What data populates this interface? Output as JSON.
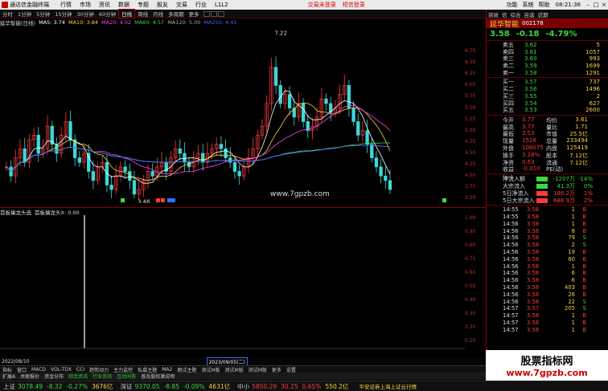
{
  "menubar": {
    "app_title": "通达信金融终端",
    "items": [
      "行情",
      "市场",
      "资讯",
      "数据",
      "专题",
      "股友",
      "交易",
      "行业",
      "L1L2"
    ],
    "alerts": [
      "交易未登录",
      "短信登录"
    ],
    "right_items": [
      "功能",
      "系统",
      "帮助"
    ],
    "clock": "08:21:36"
  },
  "periodbar": {
    "periods": [
      "分时",
      "1分钟",
      "5分钟",
      "15分钟",
      "30分钟",
      "60分钟",
      "日线",
      "周线",
      "月线",
      "多周期",
      "更多"
    ],
    "active": "日线"
  },
  "indicator_line": {
    "title": "延华智能(日线)",
    "ma": [
      {
        "label": "MA5: 3.74",
        "color": "#ffffff"
      },
      {
        "label": "MA10: 3.84",
        "color": "#ffd23c"
      },
      {
        "label": "MA20: 4.02",
        "color": "#ff44ff"
      },
      {
        "label": "MA60: 4.57",
        "color": "#3cd83c"
      },
      {
        "label": "MA120: 5.00",
        "color": "#aaaaaa"
      },
      {
        "label": "MA250: 4.41",
        "color": "#3a6cff"
      }
    ]
  },
  "chart_annotations": {
    "high_label": "7.22",
    "low_label": "3.46",
    "watermark": "www.7gpzb.com",
    "sub_value": "0.71"
  },
  "chart_data": {
    "type": "candlestick",
    "price_axis": [
      "6.75",
      "6.50",
      "6.25",
      "6.00",
      "5.75",
      "5.50",
      "5.25",
      "5.00",
      "4.75",
      "4.50",
      "4.25",
      "4.00",
      "3.75",
      "3.50"
    ],
    "high": 7.22,
    "low": 3.46,
    "closes": [
      4.2,
      4.0,
      4.4,
      4.6,
      4.3,
      4.8,
      4.9,
      4.5,
      4.6,
      5.1,
      4.7,
      4.5,
      4.9,
      5.2,
      4.8,
      4.4,
      4.3,
      4.5,
      4.1,
      3.9,
      4.2,
      4.3,
      3.8,
      3.7,
      4.0,
      4.2,
      4.1,
      3.9,
      3.6,
      3.7,
      3.9,
      4.1,
      4.0,
      4.2,
      4.3,
      4.1,
      4.4,
      4.6,
      4.5,
      4.3,
      4.2,
      4.4,
      4.5,
      4.3,
      4.5,
      4.6,
      4.7,
      4.6,
      4.4,
      4.3,
      4.1,
      4.0,
      4.2,
      4.4,
      4.6,
      4.9,
      5.1,
      5.6,
      6.4,
      6.0,
      5.6,
      5.8,
      5.5,
      5.3,
      5.6,
      5.2,
      5.0,
      5.1,
      5.3,
      5.7,
      5.6,
      5.4,
      5.5,
      5.8,
      6.0,
      5.5,
      5.2,
      4.9,
      5.0,
      4.7,
      4.4,
      4.2,
      4.0,
      3.9,
      3.7
    ]
  },
  "sub_indicator": {
    "title": "首板擒龙头选",
    "label": "首板擒龙头X: 0.00",
    "axis": [
      "1.00",
      "0.90",
      "0.80",
      "0.71",
      "0.60",
      "0.50",
      "0.40",
      "0.30",
      "0.20",
      "0.10"
    ]
  },
  "date_axis": {
    "left": "2022/08/10",
    "mid": "2023/09/05(二)"
  },
  "tabs1": [
    "指标",
    "窗口",
    "MACD",
    "VOL-TDX",
    "CCI",
    "趋势动力",
    "主力监控",
    "私募主题",
    "MA2",
    "朗试主题",
    "测试M版",
    "测试M版",
    "测试M版",
    "更多",
    "设置"
  ],
  "tabs2": {
    "items": [
      "扩展A",
      "关联报价",
      "资金分布",
      "综合资讯",
      "行业资讯",
      "互动问答",
      "普及股权激说明"
    ],
    "green_index": [
      3,
      4,
      5
    ]
  },
  "status": {
    "items": [
      {
        "label": "上证",
        "value": "3078.49",
        "chg": "-8.32",
        "pct": "-0.27%",
        "vol": "3676亿"
      },
      {
        "label": "深证",
        "value": "9370.05",
        "chg": "-8.85",
        "pct": "-0.09%",
        "vol": "4631亿"
      },
      {
        "label": "中小",
        "value": "5850.29",
        "chg": "30.25",
        "pct": "0.65%",
        "vol": "550.2亿"
      }
    ],
    "right_text": "平安证券上海上证云行情"
  },
  "rpanel": {
    "top": [
      "资收",
      "信",
      "综合",
      "自选",
      "近期"
    ],
    "name": "延华智能",
    "code": "002178",
    "price": "3.58",
    "change": "-0.18",
    "pct": "-4.79%",
    "asks": [
      {
        "k": "卖五",
        "p": "3.62",
        "v": "5"
      },
      {
        "k": "卖四",
        "p": "3.61",
        "v": "1057"
      },
      {
        "k": "卖三",
        "p": "3.60",
        "v": "993"
      },
      {
        "k": "卖二",
        "p": "3.59",
        "v": "1699"
      },
      {
        "k": "卖一",
        "p": "3.58",
        "v": "1291"
      }
    ],
    "bids": [
      {
        "k": "买一",
        "p": "3.57",
        "v": "737"
      },
      {
        "k": "买二",
        "p": "3.56",
        "v": "1496"
      },
      {
        "k": "买三",
        "p": "3.55",
        "v": "2"
      },
      {
        "k": "买四",
        "p": "3.54",
        "v": "627"
      },
      {
        "k": "买五",
        "p": "3.53",
        "v": "2600"
      }
    ],
    "stats": [
      {
        "k": "今开",
        "v": "3.77",
        "k2": "均价",
        "v2": "3.61"
      },
      {
        "k": "最高",
        "v": "3.77",
        "k2": "量比",
        "v2": "1.71"
      },
      {
        "k": "最低",
        "v": "3.53",
        "k2": "市值",
        "v2": "25.5亿"
      },
      {
        "k": "现量",
        "v": "1526",
        "k2": "总量",
        "v2": "233494"
      },
      {
        "k": "外盘",
        "v": "108075",
        "k2": "内盘",
        "v2": "125419"
      },
      {
        "k": "换手",
        "v": "3.28%",
        "k2": "股本",
        "v2": "7.12亿"
      },
      {
        "k": "净资",
        "v": "0.63",
        "k2": "流通",
        "v2": "7.12亿"
      },
      {
        "k": "收益(一)",
        "v": "-0.010",
        "k2": "PE(动)",
        "v2": ""
      }
    ],
    "flows": [
      {
        "k": "净流入额",
        "v": "-1207万",
        "p": "-14%",
        "bar": "#3cd83c"
      },
      {
        "k": "大宗流入",
        "v": "41.3万",
        "p": "0%",
        "bar": "#3cd83c"
      },
      {
        "k": "5日净流入",
        "v": "186.2万",
        "p": "1%",
        "bar": "#ff3b3b"
      },
      {
        "k": "5日大宗流入",
        "v": "688.9万",
        "p": "2%",
        "bar": "#ff3b3b"
      }
    ],
    "ticks": [
      {
        "t": "14:55",
        "p": "3.58",
        "v": "1",
        "d": "B"
      },
      {
        "t": "14:55",
        "p": "3.58",
        "v": "1",
        "d": "B"
      },
      {
        "t": "14:56",
        "p": "3.58",
        "v": "1",
        "d": "B"
      },
      {
        "t": "14:56",
        "p": "3.58",
        "v": "8",
        "d": "B"
      },
      {
        "t": "14:56",
        "p": "3.58",
        "v": "79",
        "d": "S"
      },
      {
        "t": "14:56",
        "p": "3.58",
        "v": "2",
        "d": "S"
      },
      {
        "t": "14:56",
        "p": "3.58",
        "v": "19",
        "d": "B"
      },
      {
        "t": "14:56",
        "p": "3.58",
        "v": "60",
        "d": "B"
      },
      {
        "t": "14:56",
        "p": "3.58",
        "v": "1",
        "d": "B"
      },
      {
        "t": "14:56",
        "p": "3.58",
        "v": "6",
        "d": "B"
      },
      {
        "t": "14:56",
        "p": "3.58",
        "v": "6",
        "d": "B"
      },
      {
        "t": "14:56",
        "p": "3.58",
        "v": "403",
        "d": "B"
      },
      {
        "t": "14:56",
        "p": "3.58",
        "v": "26",
        "d": "B"
      },
      {
        "t": "14:56",
        "p": "3.58",
        "v": "22",
        "d": "S"
      },
      {
        "t": "14:57",
        "p": "3.57",
        "v": "205",
        "d": "S"
      },
      {
        "t": "14:57",
        "p": "3.58",
        "v": "1",
        "d": "B"
      },
      {
        "t": "14:57",
        "p": "3.58",
        "v": "1",
        "d": "B"
      },
      {
        "t": "14:57",
        "p": "3.58",
        "v": "1",
        "d": "B"
      }
    ]
  },
  "watermark": {
    "big": "股票指标网",
    "url": "www.7gpzb.com"
  }
}
